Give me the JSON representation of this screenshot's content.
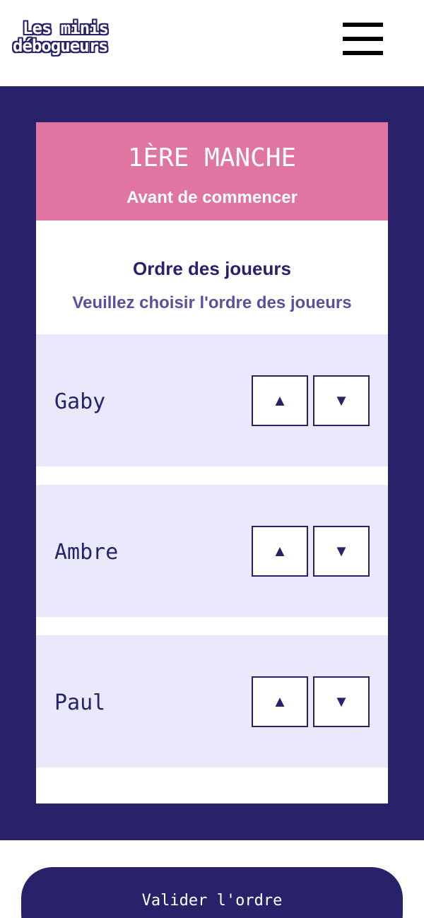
{
  "header": {
    "logo_line1": "Les minis",
    "logo_line2": "débogueurs",
    "menu_icon": "hamburger-menu-icon"
  },
  "card": {
    "round_title": "1ÈRE MANCHE",
    "round_subtitle": "Avant de commencer",
    "section_title": "Ordre des joueurs",
    "section_subtitle": "Veuillez choisir l'ordre des joueurs"
  },
  "players": [
    {
      "name": "Gaby",
      "up": "▲",
      "down": "▼"
    },
    {
      "name": "Ambre",
      "up": "▲",
      "down": "▼"
    },
    {
      "name": "Paul",
      "up": "▲",
      "down": "▼"
    }
  ],
  "actions": {
    "validate_label": "Valider l'ordre"
  },
  "colors": {
    "primary": "#27226a",
    "accent_pink": "#e075a1",
    "row_bg": "#eae9fb",
    "subtitle": "#5d4f9b"
  }
}
